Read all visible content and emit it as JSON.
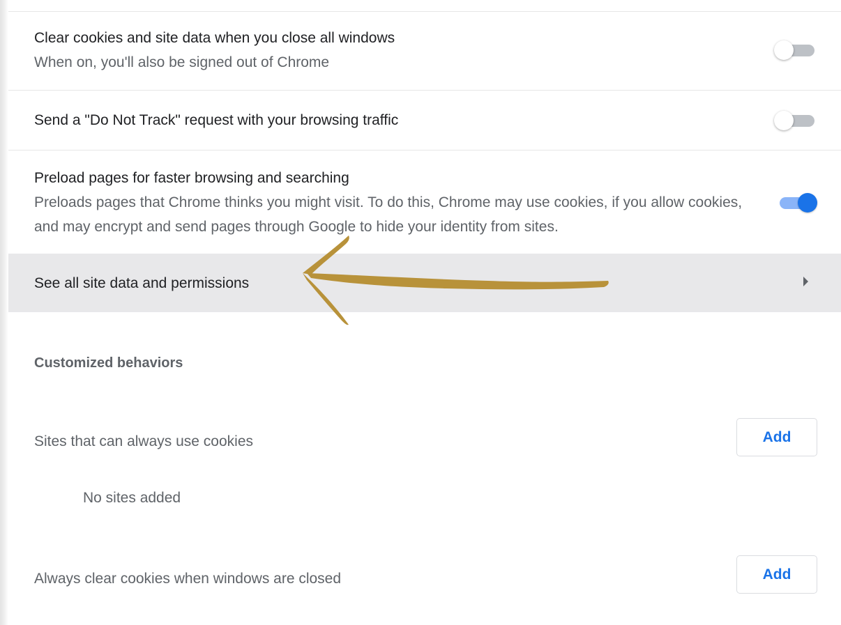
{
  "settings": {
    "clear_cookies": {
      "title": "Clear cookies and site data when you close all windows",
      "subtitle": "When on, you'll also be signed out of Chrome",
      "enabled": false
    },
    "do_not_track": {
      "title": "Send a \"Do Not Track\" request with your browsing traffic",
      "enabled": false
    },
    "preload": {
      "title": "Preload pages for faster browsing and searching",
      "subtitle": "Preloads pages that Chrome thinks you might visit. To do this, Chrome may use cookies, if you allow cookies, and may encrypt and send pages through Google to hide your identity from sites.",
      "enabled": true
    },
    "site_data_link": {
      "label": "See all site data and permissions"
    }
  },
  "customized": {
    "heading": "Customized behaviors",
    "always_use": {
      "label": "Sites that can always use cookies",
      "add_label": "Add",
      "empty_text": "No sites added"
    },
    "always_clear": {
      "label": "Always clear cookies when windows are closed",
      "add_label": "Add"
    }
  },
  "colors": {
    "accent": "#1a73e8",
    "annotation_arrow": "#b8923a",
    "highlight_row": "#e8e8ea"
  }
}
